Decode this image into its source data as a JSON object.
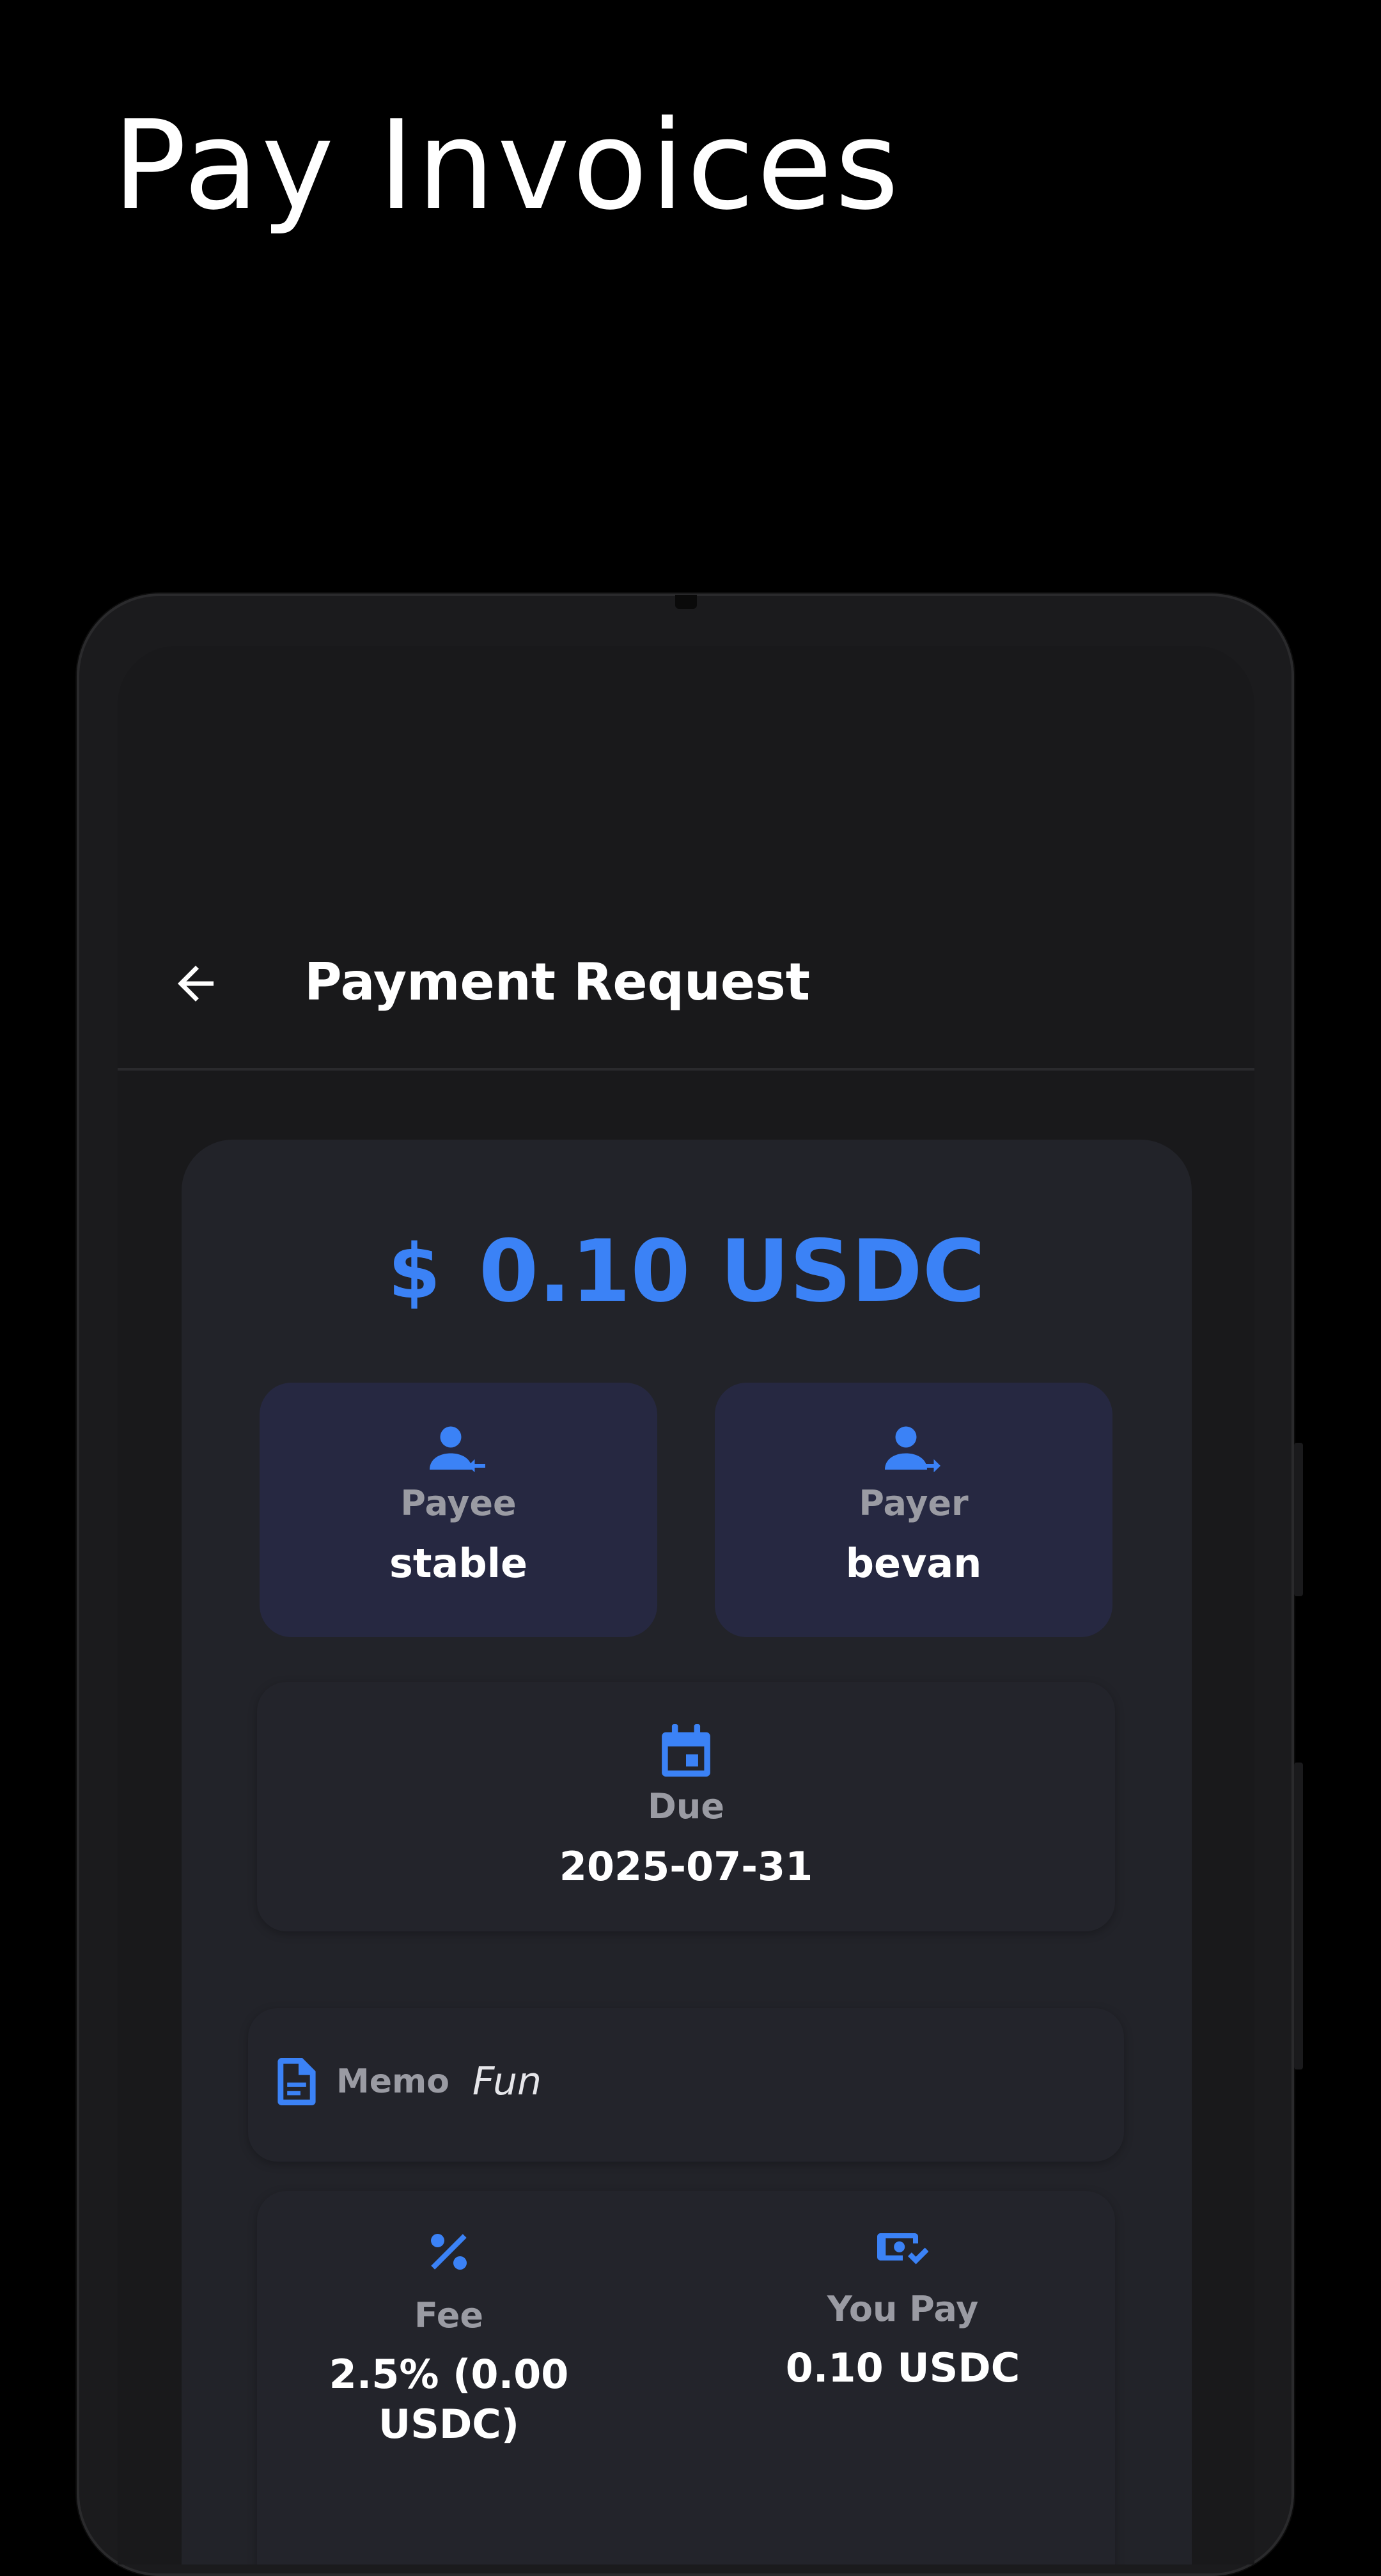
{
  "headline": "Pay Invoices",
  "appbar": {
    "title": "Payment Request",
    "back_icon": "arrow-left-icon"
  },
  "payment": {
    "currency_symbol": "$",
    "amount": "0.10 USDC",
    "payee": {
      "label": "Payee",
      "value": "stable",
      "icon": "person-arrow-left-icon"
    },
    "payer": {
      "label": "Payer",
      "value": "bevan",
      "icon": "person-arrow-right-icon"
    },
    "due": {
      "label": "Due",
      "value": "2025-07-31",
      "icon": "calendar-icon"
    },
    "memo": {
      "label": "Memo",
      "value": "Fun",
      "icon": "document-icon"
    },
    "fee": {
      "label": "Fee",
      "value": "2.5% (0.00 USDC)",
      "icon": "percent-icon"
    },
    "you_pay": {
      "label": "You Pay",
      "value": "0.10 USDC",
      "icon": "payment-check-icon"
    }
  },
  "colors": {
    "accent": "#3b82f6",
    "background": "#000000",
    "card": "#222329",
    "tile": "#262841"
  }
}
